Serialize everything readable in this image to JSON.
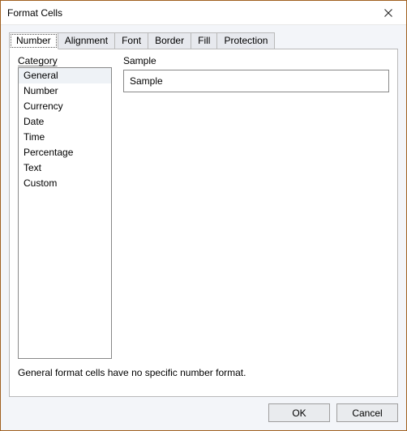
{
  "window": {
    "title": "Format Cells"
  },
  "tabs": [
    {
      "label": "Number",
      "active": true
    },
    {
      "label": "Alignment",
      "active": false
    },
    {
      "label": "Font",
      "active": false
    },
    {
      "label": "Border",
      "active": false
    },
    {
      "label": "Fill",
      "active": false
    },
    {
      "label": "Protection",
      "active": false
    }
  ],
  "number_tab": {
    "category_label": "Category",
    "categories": [
      {
        "label": "General",
        "selected": true
      },
      {
        "label": "Number",
        "selected": false
      },
      {
        "label": "Currency",
        "selected": false
      },
      {
        "label": "Date",
        "selected": false
      },
      {
        "label": "Time",
        "selected": false
      },
      {
        "label": "Percentage",
        "selected": false
      },
      {
        "label": "Text",
        "selected": false
      },
      {
        "label": "Custom",
        "selected": false
      }
    ],
    "sample_label": "Sample",
    "sample_value": "Sample",
    "description": "General format cells have no specific number format."
  },
  "buttons": {
    "ok": "OK",
    "cancel": "Cancel"
  }
}
